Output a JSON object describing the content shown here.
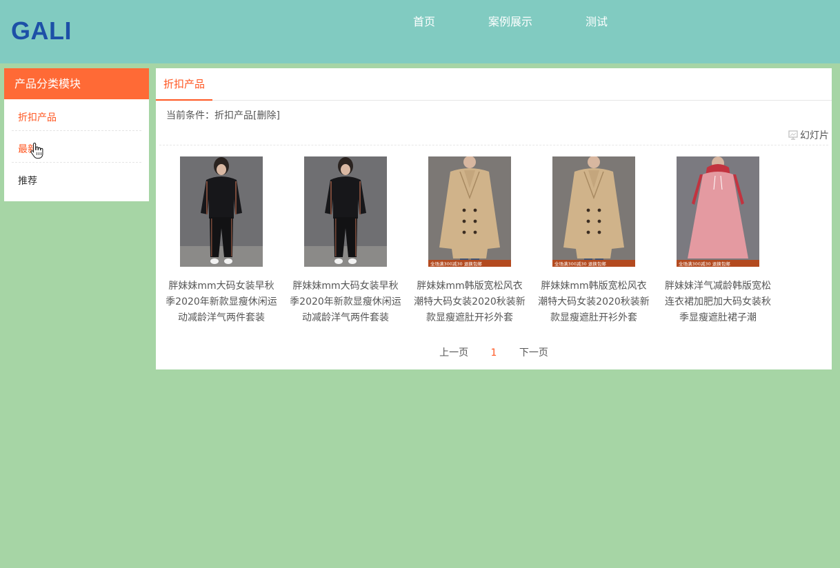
{
  "header": {
    "logo": "GALI",
    "nav": [
      "首页",
      "案例展示",
      "测试"
    ]
  },
  "sidebar": {
    "title": "产品分类模块",
    "items": [
      "折扣产品",
      "最新",
      "推荐"
    ]
  },
  "main": {
    "tab": "折扣产品",
    "condition_prefix": "当前条件：",
    "condition_value": "折扣产品",
    "condition_delete": "[删除]",
    "slideshow_label": "幻灯片",
    "products": [
      {
        "title": "胖妹妹mm大码女装早秋季2020年新款显瘦休闲运动减龄洋气两件套装",
        "image": "black-tracksuit"
      },
      {
        "title": "胖妹妹mm大码女装早秋季2020年新款显瘦休闲运动减龄洋气两件套装",
        "image": "black-tracksuit"
      },
      {
        "title": "胖妹妹mm韩版宽松风衣潮特大码女装2020秋装新款显瘦遮肚开衫外套",
        "image": "khaki-trench-coat",
        "banner": "全场满300减30 退换包邮"
      },
      {
        "title": "胖妹妹mm韩版宽松风衣潮特大码女装2020秋装新款显瘦遮肚开衫外套",
        "image": "khaki-trench-coat",
        "banner": "全场满300减30 退换包邮"
      },
      {
        "title": "胖妹妹洋气减龄韩版宽松连衣裙加肥加大码女装秋季显瘦遮肚裙子潮",
        "image": "pink-dress",
        "banner": "全场满300减30 退换包邮"
      }
    ],
    "pager": {
      "prev": "上一页",
      "current": "1",
      "next": "下一页"
    }
  },
  "colors": {
    "page_bg": "#a6d5a5",
    "header_bg": "#81cbc1",
    "logo": "#1d50a7",
    "accent": "#ff5722",
    "sidebar_title_bg": "#ff6a36"
  }
}
